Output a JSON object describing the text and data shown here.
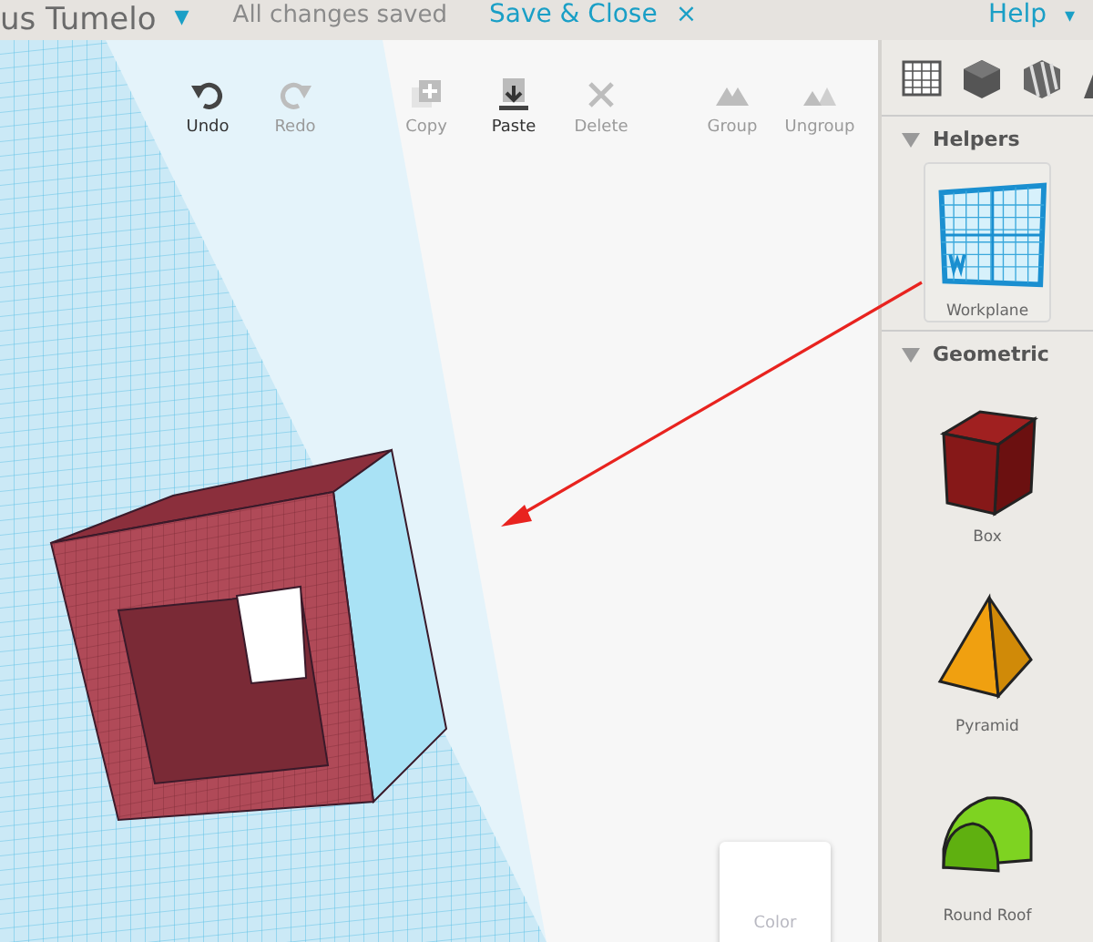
{
  "header": {
    "title": "us Tumelo",
    "title_caret": "▾",
    "save_status": "All changes saved",
    "save_close": "Save & Close",
    "close_mark": "×",
    "help": "Help",
    "help_caret": "▾"
  },
  "toolbar": [
    {
      "kind": "undo",
      "label": "Undo",
      "disabled": false
    },
    {
      "kind": "redo",
      "label": "Redo",
      "disabled": true
    },
    {
      "kind": "copy",
      "label": "Copy",
      "disabled": true
    },
    {
      "kind": "paste",
      "label": "Paste",
      "disabled": false
    },
    {
      "kind": "delete",
      "label": "Delete",
      "disabled": true
    },
    {
      "kind": "group",
      "label": "Group",
      "disabled": true
    },
    {
      "kind": "ungroup",
      "label": "Ungroup",
      "disabled": true
    }
  ],
  "color_button": {
    "label": "Color"
  },
  "sidebar": {
    "tabs": [
      {
        "kind": "grid",
        "selected": false
      },
      {
        "kind": "cube",
        "selected": false
      },
      {
        "kind": "striped",
        "selected": false
      },
      {
        "kind": "letter",
        "selected": false
      }
    ],
    "sections": [
      {
        "title": "Helpers",
        "expanded": true,
        "items": [
          {
            "kind": "workplane",
            "label": "Workplane",
            "selected": true
          }
        ]
      },
      {
        "title": "Geometric",
        "expanded": true,
        "items": [
          {
            "kind": "box",
            "label": "Box",
            "selected": false
          },
          {
            "kind": "pyramid",
            "label": "Pyramid",
            "selected": false
          },
          {
            "kind": "roof",
            "label": "Round Roof",
            "selected": false
          }
        ]
      }
    ]
  }
}
